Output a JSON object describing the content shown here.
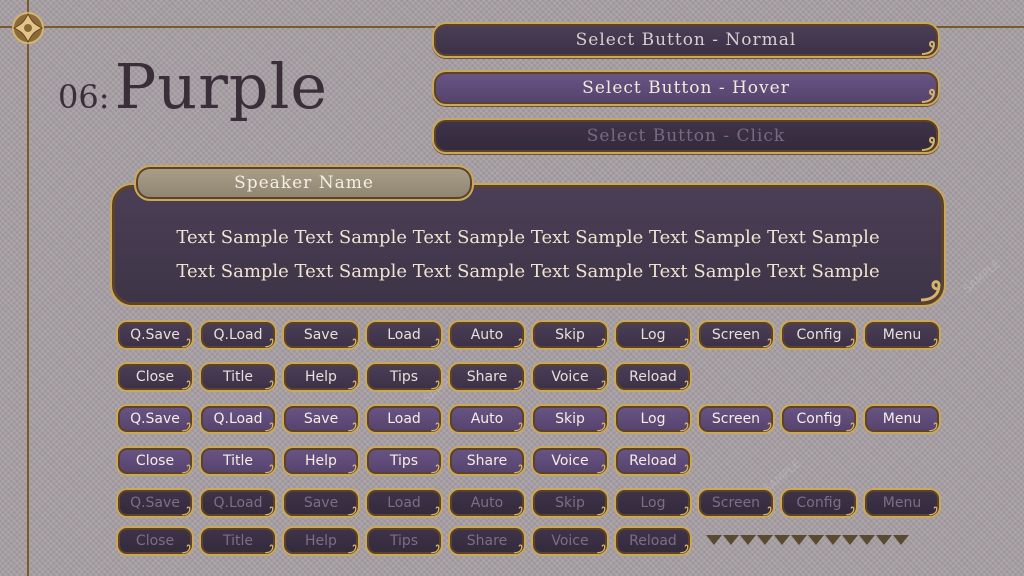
{
  "title": {
    "number": "06:",
    "name": "Purple"
  },
  "select_buttons": {
    "normal": "Select Button - Normal",
    "hover": "Select Button - Hover",
    "click": "Select Button - Click"
  },
  "dialog": {
    "speaker": "Speaker Name",
    "line1": "Text Sample Text Sample Text Sample Text Sample Text Sample Text Sample",
    "line2": "Text Sample Text Sample Text Sample Text Sample Text Sample Text Sample"
  },
  "button_rows": [
    {
      "state": "normal",
      "labels": [
        "Q.Save",
        "Q.Load",
        "Save",
        "Load",
        "Auto",
        "Skip",
        "Log",
        "Screen",
        "Config",
        "Menu"
      ]
    },
    {
      "state": "normal",
      "labels": [
        "Close",
        "Title",
        "Help",
        "Tips",
        "Share",
        "Voice",
        "Reload"
      ]
    },
    {
      "state": "hover",
      "labels": [
        "Q.Save",
        "Q.Load",
        "Save",
        "Load",
        "Auto",
        "Skip",
        "Log",
        "Screen",
        "Config",
        "Menu"
      ]
    },
    {
      "state": "hover",
      "labels": [
        "Close",
        "Title",
        "Help",
        "Tips",
        "Share",
        "Voice",
        "Reload"
      ]
    },
    {
      "state": "click",
      "labels": [
        "Q.Save",
        "Q.Load",
        "Save",
        "Load",
        "Auto",
        "Skip",
        "Log",
        "Screen",
        "Config",
        "Menu"
      ]
    },
    {
      "state": "click",
      "labels": [
        "Close",
        "Title",
        "Help",
        "Tips",
        "Share",
        "Voice",
        "Reload"
      ]
    }
  ],
  "watermark": "SAMPLE",
  "colors": {
    "background": "#a69ea3",
    "gold_border": "#c9a85a",
    "purple_normal": "#4b3f57",
    "purple_hover": "#6a5585",
    "purple_click": "#3f3349",
    "speaker_tab": "#aa9f8a"
  },
  "icons": {
    "corner": "ornament-icon",
    "swirl": "swirl-icon",
    "arrow": "page-arrow-icon"
  }
}
